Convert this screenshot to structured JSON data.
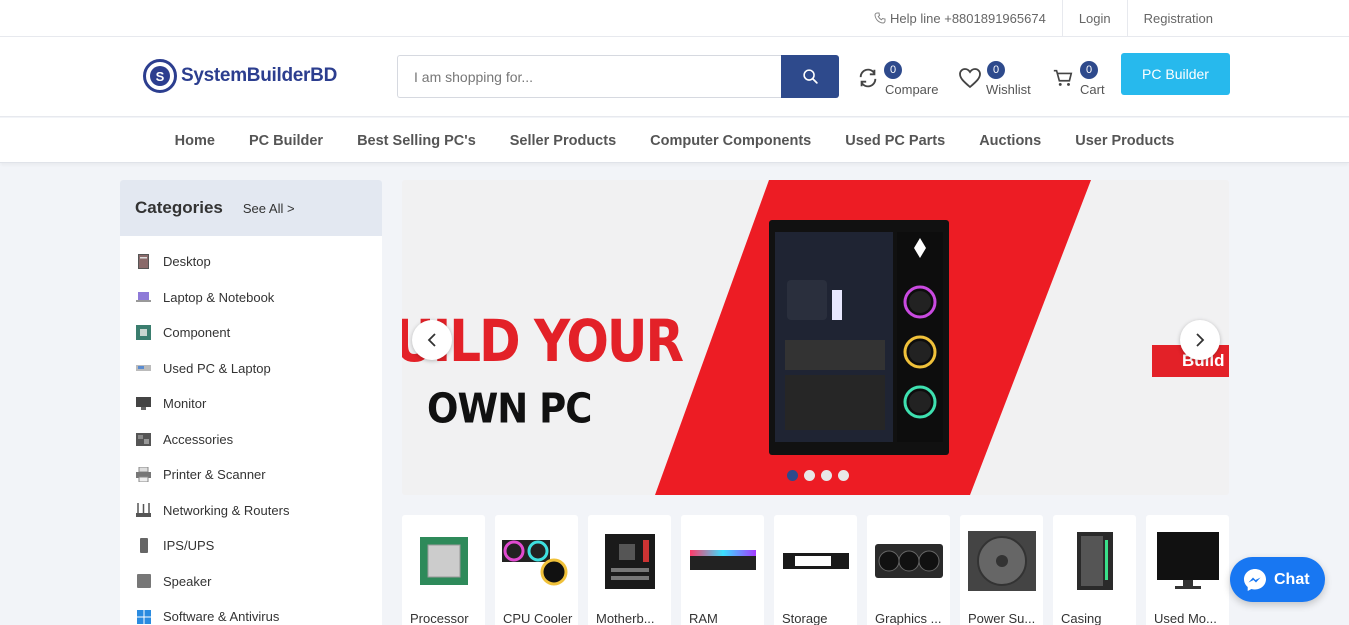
{
  "topbar": {
    "helpline": "Help line +8801891965674",
    "login": "Login",
    "registration": "Registration"
  },
  "header": {
    "logo_text": "SystemBuilderBD",
    "logo_letter": "S",
    "search_placeholder": "I am shopping for...",
    "compare": {
      "label": "Compare",
      "count": "0"
    },
    "wishlist": {
      "label": "Wishlist",
      "count": "0"
    },
    "cart": {
      "label": "Cart",
      "count": "0"
    },
    "pc_builder_button": "PC Builder"
  },
  "nav": {
    "items": [
      "Home",
      "PC Builder",
      "Best Selling PC's",
      "Seller Products",
      "Computer Components",
      "Used PC Parts",
      "Auctions",
      "User Products"
    ]
  },
  "sidebar": {
    "title": "Categories",
    "see_all": "See All >",
    "items": [
      "Desktop",
      "Laptop & Notebook",
      "Component",
      "Used PC & Laptop",
      "Monitor",
      "Accessories",
      "Printer & Scanner",
      "Networking & Routers",
      "IPS/UPS",
      "Speaker",
      "Software & Antivirus"
    ]
  },
  "banner": {
    "line1": "UILD YOUR",
    "line2": "OWN PC",
    "cta": "Build N",
    "active_slide": 1,
    "slide_count": 4,
    "colors": {
      "red": "#e32128",
      "accent": "#2e4a8c"
    }
  },
  "tiles": [
    "Processor",
    "CPU Cooler",
    "Motherb...",
    "RAM",
    "Storage",
    "Graphics ...",
    "Power Su...",
    "Casing",
    "Used Mo..."
  ],
  "chat": {
    "label": "Chat"
  },
  "colors": {
    "primary": "#2e4a8c",
    "button": "#27b9ed",
    "messenger": "#1877f2"
  }
}
